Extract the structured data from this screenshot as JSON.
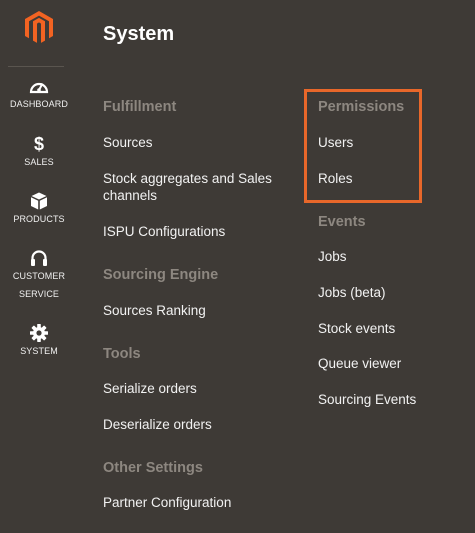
{
  "nav": {
    "items": [
      {
        "label": "DASHBOARD",
        "icon": "gauge-icon"
      },
      {
        "label": "SALES",
        "icon": "dollar-icon",
        "glyph": "$"
      },
      {
        "label": "PRODUCTS",
        "icon": "cube-icon"
      },
      {
        "label": "CUSTOMER\nSERVICE",
        "icon": "headset-icon"
      },
      {
        "label": "SYSTEM",
        "icon": "gear-icon"
      }
    ]
  },
  "panel": {
    "title": "System",
    "sections": {
      "fulfillment": {
        "title": "Fulfillment",
        "links": [
          "Sources",
          "Stock aggregates and Sales\nchannels",
          "ISPU Configurations"
        ]
      },
      "sourcing_engine": {
        "title": "Sourcing Engine",
        "links": [
          "Sources Ranking"
        ]
      },
      "tools": {
        "title": "Tools",
        "links": [
          "Serialize orders",
          "Deserialize orders"
        ]
      },
      "other_settings": {
        "title": "Other Settings",
        "links": [
          "Partner Configuration"
        ]
      },
      "permissions": {
        "title": "Permissions",
        "links": [
          "Users",
          "Roles"
        ]
      },
      "events": {
        "title": "Events",
        "links": [
          "Jobs",
          "Jobs (beta)",
          "Stock events",
          "Queue viewer",
          "Sourcing Events"
        ]
      }
    }
  },
  "colors": {
    "background": "#3e3a36",
    "section_title": "#8d8780",
    "highlight": "#e8672a",
    "logo": "#f26322"
  }
}
